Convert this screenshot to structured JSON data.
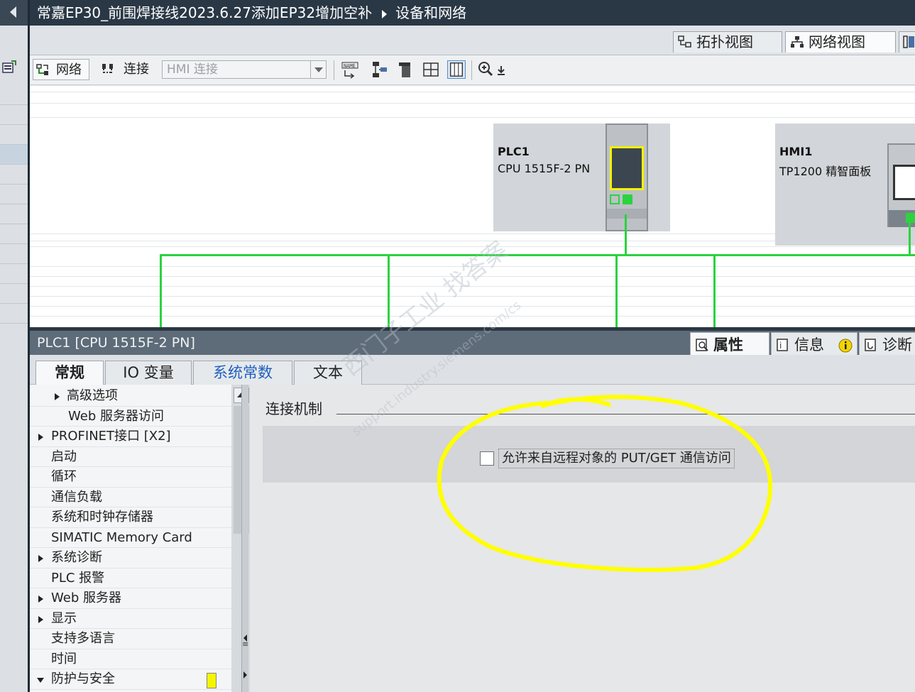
{
  "title_bar": {
    "project": "常嘉EP30_前围焊接线2023.6.27添加EP32增加空补",
    "page": "设备和网络"
  },
  "view_tabs": [
    {
      "label": "拓扑视图",
      "active": false
    },
    {
      "label": "网络视图",
      "active": true
    },
    {
      "label": "",
      "active": false
    }
  ],
  "toolbar": {
    "network_label": "网络",
    "connection_label": "连接",
    "hmi_select_value": "HMI 连接"
  },
  "devices": [
    {
      "name": "PLC1",
      "model": "CPU 1515F-2 PN"
    },
    {
      "name": "HMI1",
      "model": "TP1200 精智面板"
    }
  ],
  "inspector": {
    "title": "PLC1 [CPU 1515F-2 PN]",
    "tabs": [
      {
        "label": "属性",
        "active": true
      },
      {
        "label": "信息",
        "active": false
      },
      {
        "label": "诊断",
        "active": false
      }
    ],
    "sub_tabs": [
      {
        "label": "常规",
        "active": true
      },
      {
        "label": "IO 变量",
        "active": false
      },
      {
        "label": "系统常数",
        "active": false
      },
      {
        "label": "文本",
        "active": false
      }
    ]
  },
  "nav_items": [
    {
      "label": "高级选项",
      "indent": 1,
      "arrow": "right"
    },
    {
      "label": "Web 服务器访问",
      "indent": 2,
      "arrow": "none"
    },
    {
      "label": "PROFINET接口 [X2]",
      "indent": 0,
      "arrow": "right"
    },
    {
      "label": "启动",
      "indent": 0,
      "arrow": "none"
    },
    {
      "label": "循环",
      "indent": 0,
      "arrow": "none"
    },
    {
      "label": "通信负载",
      "indent": 0,
      "arrow": "none"
    },
    {
      "label": "系统和时钟存储器",
      "indent": 0,
      "arrow": "none"
    },
    {
      "label": "SIMATIC Memory Card",
      "indent": 0,
      "arrow": "none"
    },
    {
      "label": "系统诊断",
      "indent": 0,
      "arrow": "right"
    },
    {
      "label": "PLC 报警",
      "indent": 0,
      "arrow": "none"
    },
    {
      "label": "Web 服务器",
      "indent": 0,
      "arrow": "right"
    },
    {
      "label": "显示",
      "indent": 0,
      "arrow": "right"
    },
    {
      "label": "支持多语言",
      "indent": 0,
      "arrow": "none"
    },
    {
      "label": "时间",
      "indent": 0,
      "arrow": "none"
    },
    {
      "label": "防护与安全",
      "indent": 0,
      "arrow": "down"
    }
  ],
  "content": {
    "section_title": "连接机制",
    "putget_label": "允许来自远程对象的 PUT/GET 通信访问",
    "putget_checked": false
  },
  "watermark": {
    "line1": "西门子工业 找答案",
    "line2": "support.industry.siemens.com/cs"
  },
  "colors": {
    "network_line": "#2bd33f",
    "highlight_ellipse": "#ffff00",
    "title_bar_bg": "#2a3846"
  }
}
